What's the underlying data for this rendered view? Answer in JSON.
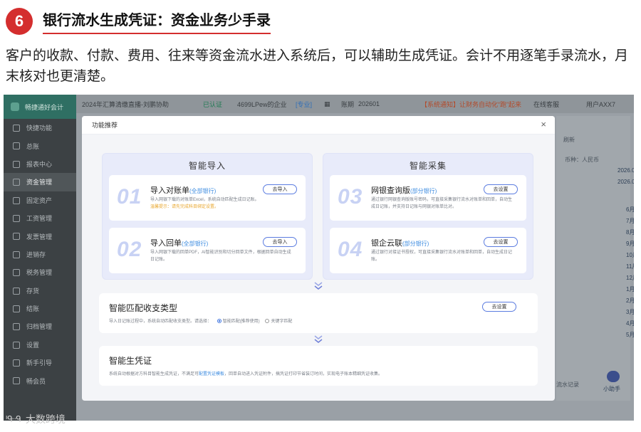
{
  "article": {
    "badge": "6",
    "title": "银行流水生成凭证：资金业务少手录",
    "intro": "客户的收款、付款、费用、往来等资金流水进入系统后，可以辅助生成凭证。会计不用逐笔手录流水，月末核对也更清楚。"
  },
  "app": {
    "brand": "畅捷通好会计",
    "sidebar": [
      "快捷功能",
      "总账",
      "报表中心",
      "资金管理",
      "固定资产",
      "工资管理",
      "发票管理",
      "进销存",
      "税务管理",
      "存货",
      "结账",
      "归档管理",
      "设置",
      "新手引导",
      "畅会员"
    ],
    "active_index": 3,
    "topbar": {
      "account_set": "2024年汇算清缴直播-刘鹏协助",
      "verified": "已认证",
      "company": "4699LPew的企业",
      "tag": "[专业]",
      "period_label": "账期",
      "period": "202601",
      "notice": "【系统通知】让财务自动化“跑”起来",
      "online_service": "在线客服",
      "user": "用户AXX7"
    },
    "bg": {
      "refresh": "刷新",
      "currency": "币种：人民币",
      "date1": "2026.0",
      "date2": "2026.0",
      "months": [
        "6月",
        "7月",
        "8月",
        "9月",
        "10月",
        "11月",
        "12月",
        "1月",
        "2月",
        "3月",
        "4月",
        "5月"
      ],
      "records": "流水记录",
      "assistant": "小助手"
    }
  },
  "modal": {
    "title": "功能推荐",
    "close": "×",
    "import": {
      "title": "智能导入",
      "cards": [
        {
          "num": "01",
          "title": "导入对账单",
          "tag": "(全部银行)",
          "desc": "导入网银下载的对账单Excel，系统自动匹配生成日记账。",
          "warn_label": "温馨提示：",
          "warn": "请先完成科目绑定设置。",
          "button": "去导入"
        },
        {
          "num": "02",
          "title": "导入回单",
          "tag": "(全部银行)",
          "desc": "导入网银下载的回单PDF，AI智能识别和切分回单文件，根据回单自动生成日记账。",
          "button": "去导入"
        }
      ]
    },
    "collect": {
      "title": "智能采集",
      "cards": [
        {
          "num": "03",
          "title": "网银查询版",
          "tag": "(部分银行)",
          "desc": "通过银行网银查询版账号密码，可直接采集银行流水对账单和回单，自动生成日记账，并支持日记账与网银对账单比对。",
          "button": "去设置"
        },
        {
          "num": "04",
          "title": "银企云联",
          "tag": "(部分银行)",
          "desc": "通过银行对接证书授权，可直接采集银行流水对账单和回单，自动生成日记账。",
          "button": "去设置"
        }
      ]
    },
    "match": {
      "title": "智能匹配收支类型",
      "desc": "导入日记账过程中，系统自动匹配收支类型。请选择：",
      "option1": "智能匹配(推荐使用)",
      "option2": "关键字匹配",
      "button": "去设置"
    },
    "voucher": {
      "title": "智能生凭证",
      "desc_prefix": "系统自动根据对方科目智能生成凭证，不满足可",
      "desc_link": "配置凭证模板",
      "desc_suffix": "，回单自动进入凭证附件，搞凭证打印节省装订时间，实现电子账本精细凭证收集。"
    }
  },
  "watermark": {
    "logo": "ᑊᑵᑴ",
    "text": "大数跨境"
  }
}
